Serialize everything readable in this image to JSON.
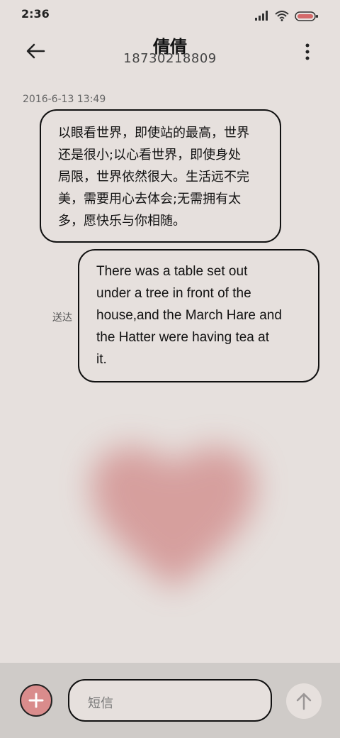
{
  "status_bar": {
    "time": "2:36"
  },
  "header": {
    "title": "倩倩",
    "phone": "18730218809"
  },
  "conversation": {
    "timestamp": "2016-6-13 13:49",
    "incoming": {
      "lines": [
        "以眼看世界，即使站的最高，世界",
        "还是很小;以心看世界，即使身处",
        "局限，世界依然很大。生活远不完",
        "美，需要用心去体会;无需拥有太",
        "多，愿快乐与你相随。"
      ]
    },
    "outgoing": {
      "lines": [
        "There was a table set out",
        "under a tree in front of the",
        "house,and the March Hare and",
        "the Hatter were having tea at",
        "it."
      ],
      "status": "送达"
    }
  },
  "composer": {
    "placeholder": "短信"
  },
  "icons": [
    "back-arrow-icon",
    "more-vertical-icon",
    "signal-icon",
    "wifi-icon",
    "battery-icon",
    "plus-icon",
    "send-arrow-icon"
  ],
  "colors": {
    "background": "#e6e0dd",
    "accent": "#d98c8c",
    "bottom_bar": "#cfcbc8"
  }
}
